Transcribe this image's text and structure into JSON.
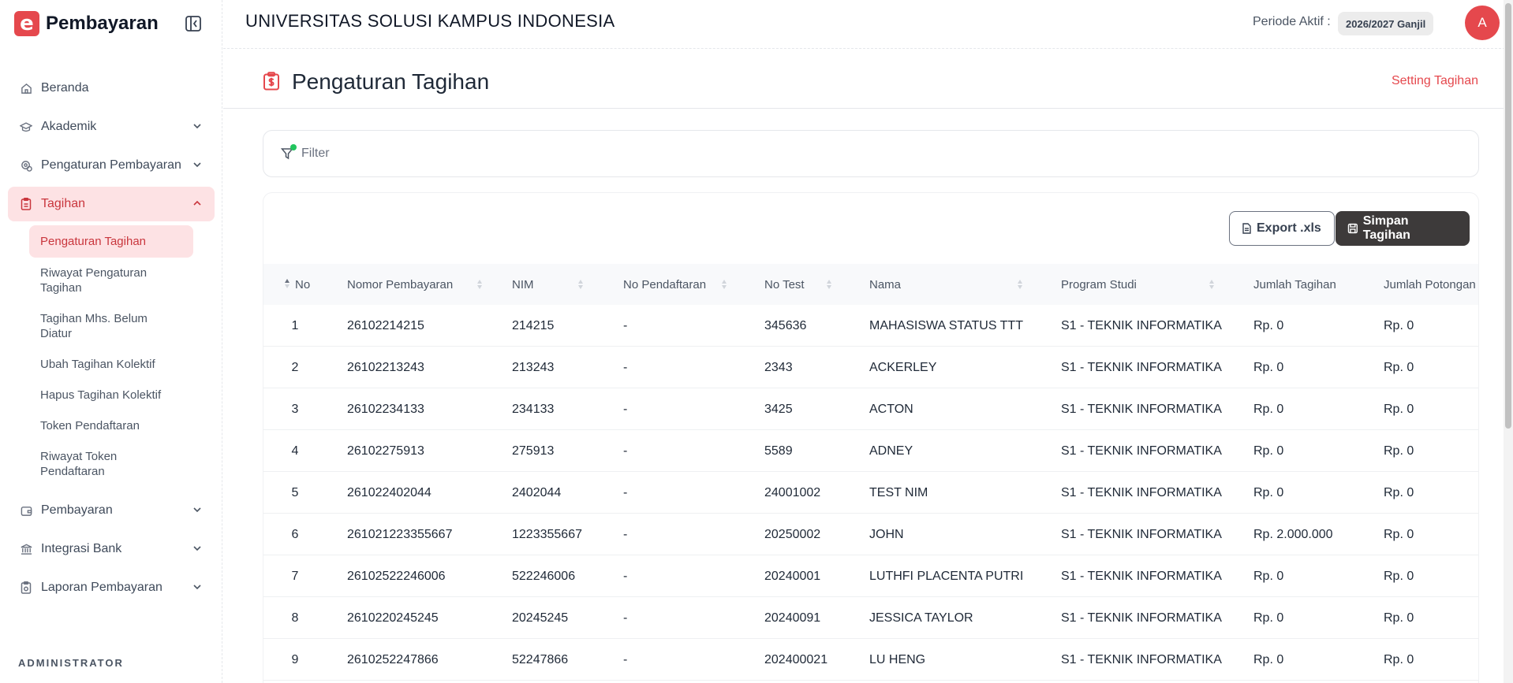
{
  "brand": {
    "logo_letter": "e",
    "name": "Pembayaran"
  },
  "nav": {
    "beranda": "Beranda",
    "akademik": "Akademik",
    "pengaturan_pembayaran": "Pengaturan Pembayaran",
    "tagihan": "Tagihan",
    "tagihan_sub": [
      "Pengaturan Tagihan",
      "Riwayat Pengaturan Tagihan",
      "Tagihan Mhs. Belum Diatur",
      "Ubah Tagihan Kolektif",
      "Hapus Tagihan Kolektif",
      "Token Pendaftaran",
      "Riwayat Token Pendaftaran"
    ],
    "pembayaran": "Pembayaran",
    "integrasi_bank": "Integrasi Bank",
    "laporan_pembayaran": "Laporan Pembayaran",
    "section_admin": "ADMINISTRATOR"
  },
  "header": {
    "university": "UNIVERSITAS SOLUSI KAMPUS INDONESIA",
    "periode_label": "Periode Aktif :",
    "periode_value": "2026/2027 Ganjil",
    "avatar_letter": "A"
  },
  "page": {
    "title": "Pengaturan Tagihan",
    "setting_link": "Setting Tagihan",
    "filter_label": "Filter",
    "export_label": "Export .xls",
    "save_label": "Simpan Tagihan"
  },
  "table": {
    "columns": [
      "No",
      "Nomor Pembayaran",
      "NIM",
      "No Pendaftaran",
      "No Test",
      "Nama",
      "Program Studi",
      "Jumlah Tagihan",
      "Jumlah Potongan"
    ],
    "rows": [
      [
        "1",
        "26102214215",
        "214215",
        "-",
        "345636",
        "MAHASISWA STATUS TTT",
        "S1 - TEKNIK INFORMATIKA",
        "Rp. 0",
        "Rp. 0"
      ],
      [
        "2",
        "26102213243",
        "213243",
        "-",
        "2343",
        "ACKERLEY",
        "S1 - TEKNIK INFORMATIKA",
        "Rp. 0",
        "Rp. 0"
      ],
      [
        "3",
        "26102234133",
        "234133",
        "-",
        "3425",
        "ACTON",
        "S1 - TEKNIK INFORMATIKA",
        "Rp. 0",
        "Rp. 0"
      ],
      [
        "4",
        "26102275913",
        "275913",
        "-",
        "5589",
        "ADNEY",
        "S1 - TEKNIK INFORMATIKA",
        "Rp. 0",
        "Rp. 0"
      ],
      [
        "5",
        "261022402044",
        "2402044",
        "-",
        "24001002",
        "TEST NIM",
        "S1 - TEKNIK INFORMATIKA",
        "Rp. 0",
        "Rp. 0"
      ],
      [
        "6",
        "261021223355667",
        "1223355667",
        "-",
        "20250002",
        "JOHN",
        "S1 - TEKNIK INFORMATIKA",
        "Rp. 2.000.000",
        "Rp. 0"
      ],
      [
        "7",
        "26102522246006",
        "522246006",
        "-",
        "20240001",
        "LUTHFI PLACENTA PUTRI",
        "S1 - TEKNIK INFORMATIKA",
        "Rp. 0",
        "Rp. 0"
      ],
      [
        "8",
        "2610220245245",
        "20245245",
        "-",
        "20240091",
        "JESSICA TAYLOR",
        "S1 - TEKNIK INFORMATIKA",
        "Rp. 0",
        "Rp. 0"
      ],
      [
        "9",
        "2610252247866",
        "52247866",
        "-",
        "202400021",
        "LU HENG",
        "S1 - TEKNIK INFORMATIKA",
        "Rp. 0",
        "Rp. 0"
      ]
    ]
  },
  "colors": {
    "accent": "#e5484d",
    "accent_soft": "#fde2e4",
    "dark_button": "#3d3a3a",
    "filter_dot": "#22c55e"
  }
}
